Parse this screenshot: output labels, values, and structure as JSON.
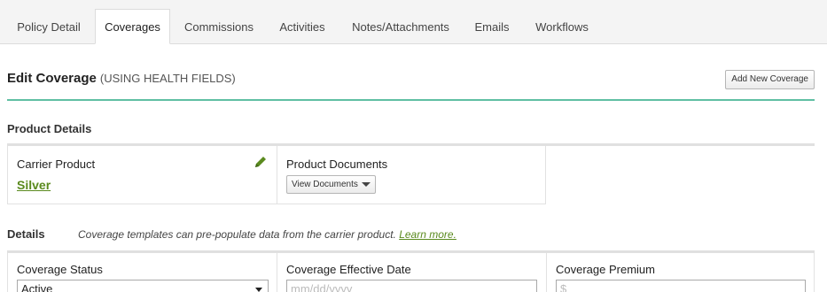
{
  "tabs": [
    {
      "label": "Policy Detail",
      "active": false
    },
    {
      "label": "Coverages",
      "active": true
    },
    {
      "label": "Commissions",
      "active": false
    },
    {
      "label": "Activities",
      "active": false
    },
    {
      "label": "Notes/Attachments",
      "active": false
    },
    {
      "label": "Emails",
      "active": false
    },
    {
      "label": "Workflows",
      "active": false
    }
  ],
  "header": {
    "title": "Edit Coverage",
    "subtitle": "(USING HEALTH FIELDS)",
    "add_button": "Add New Coverage"
  },
  "product_details": {
    "title": "Product Details",
    "carrier_label": "Carrier Product",
    "carrier_value": "Silver",
    "docs_label": "Product Documents",
    "docs_button": "View Documents"
  },
  "details": {
    "title": "Details",
    "note": "Coverage templates can pre-populate data from the carrier product.",
    "note_link": "Learn more.",
    "status_label": "Coverage Status",
    "status_value": "Active",
    "effective_label": "Coverage Effective Date",
    "effective_placeholder": "mm/dd/yyyy",
    "premium_label": "Coverage Premium",
    "premium_placeholder": "$"
  },
  "colors": {
    "accent_rule": "#5fbfa3",
    "link_green": "#5a8a1e"
  }
}
